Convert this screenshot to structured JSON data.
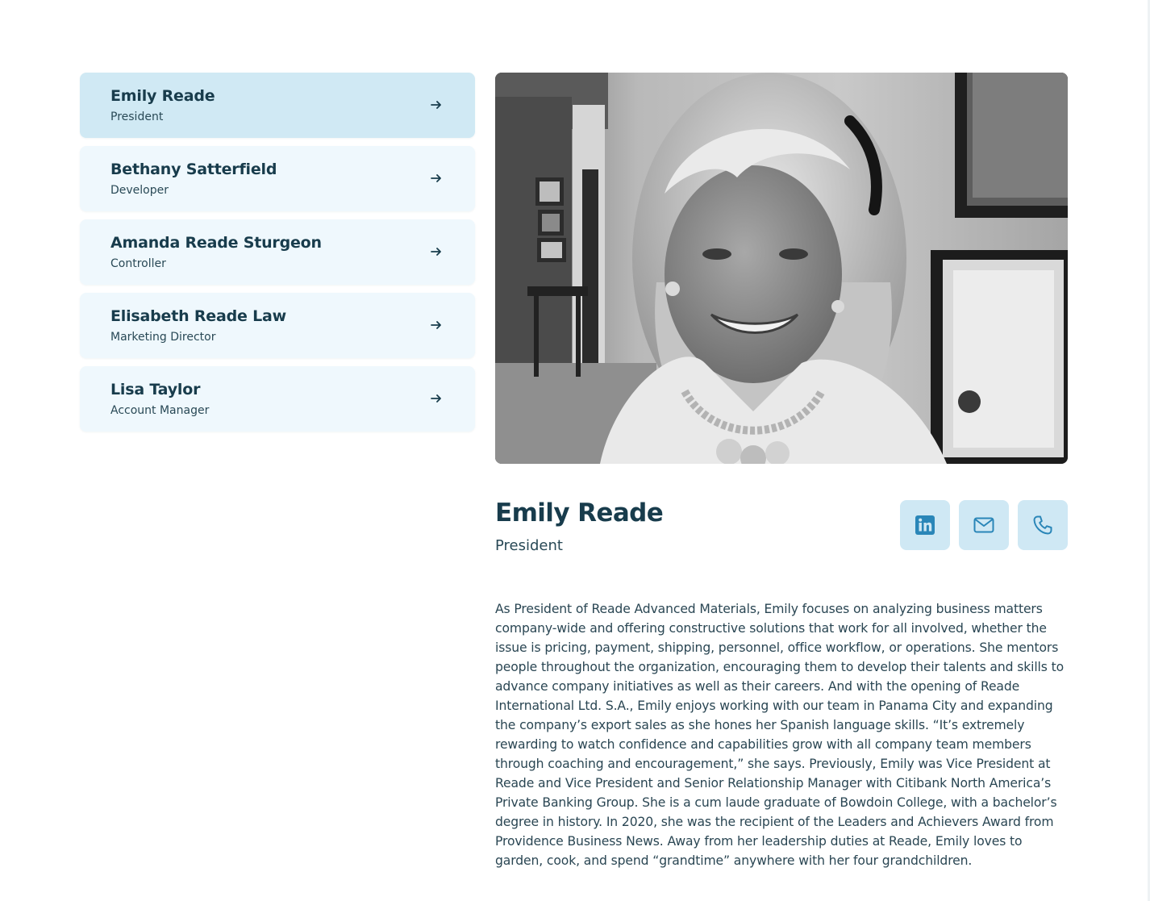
{
  "team": [
    {
      "name": "Emily Reade",
      "role": "President",
      "active": true
    },
    {
      "name": "Bethany Satterfield",
      "role": "Developer",
      "active": false
    },
    {
      "name": "Amanda Reade Sturgeon",
      "role": "Controller",
      "active": false
    },
    {
      "name": "Elisabeth Reade Law",
      "role": "Marketing Director",
      "active": false
    },
    {
      "name": "Lisa Taylor",
      "role": "Account Manager",
      "active": false
    }
  ],
  "arrow_glyph": "→",
  "selected": {
    "name": "Emily Reade",
    "role": "President",
    "bio": "As President of Reade Advanced Materials, Emily focuses on analyzing business matters company-wide and offering constructive solutions that work for all involved, whether the issue is pricing, payment, shipping, personnel, office workflow, or operations. She mentors people throughout the organization, encouraging them to develop their talents and skills to advance company initiatives as well as their careers. And with the opening of Reade International Ltd. S.A., Emily enjoys working with our team in Panama City and expanding the company’s export sales as she hones her Spanish language skills. “It’s extremely rewarding to watch confidence and capabilities grow with all company team members through coaching and encouragement,” she says. Previously, Emily was Vice President at Reade and Vice President and Senior Relationship Manager with Citibank North America’s Private Banking Group. She is a cum laude graduate of Bowdoin College, with a bachelor’s degree in history. In 2020, she was the recipient of the Leaders and Achievers Award from Providence Business News. Away from her leadership duties at Reade, Emily loves to garden, cook, and spend “grandtime” anywhere with her four grandchildren."
  },
  "social_icons": [
    "linkedin-icon",
    "mail-icon",
    "phone-icon"
  ],
  "colors": {
    "card_bg": "#eff8fd",
    "card_active_bg": "#d0e9f4",
    "heading": "#183c4c",
    "icon_blue": "#2a86b8",
    "social_bg": "#cfe8f4"
  }
}
